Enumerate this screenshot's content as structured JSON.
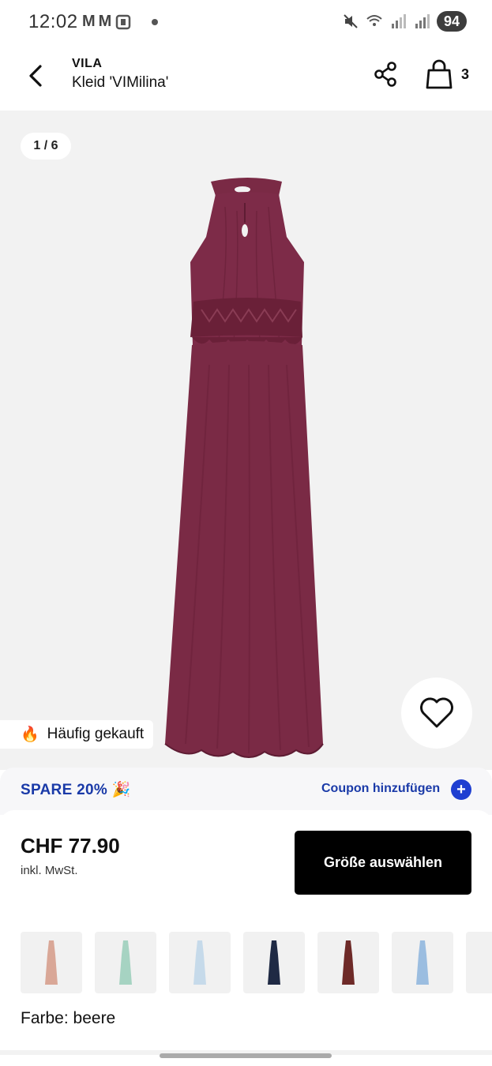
{
  "status_bar": {
    "time": "12:02",
    "notification_icons": [
      "M",
      "M"
    ],
    "battery": "94"
  },
  "header": {
    "brand": "VILA",
    "product_name": "Kleid 'VIMilina'",
    "cart_count": "3"
  },
  "gallery": {
    "counter": "1 / 6",
    "dress_color": "#7a2a45",
    "badge_emoji": "🔥",
    "badge_text": "Häufig gekauft"
  },
  "coupon": {
    "text": "SPARE 20% 🎉",
    "link": "Coupon hinzufügen",
    "plus": "+"
  },
  "purchase": {
    "price": "CHF 77.90",
    "vat": "inkl. MwSt.",
    "size_button": "Größe auswählen"
  },
  "colors": {
    "label": "Farbe: beere",
    "swatches": [
      {
        "name": "rose",
        "color": "#d9a797"
      },
      {
        "name": "mint",
        "color": "#a6d3c2"
      },
      {
        "name": "light-blue",
        "color": "#c6daea"
      },
      {
        "name": "navy",
        "color": "#1f2a44"
      },
      {
        "name": "burgundy",
        "color": "#6e2a28"
      },
      {
        "name": "blue",
        "color": "#9bbde0"
      }
    ]
  }
}
